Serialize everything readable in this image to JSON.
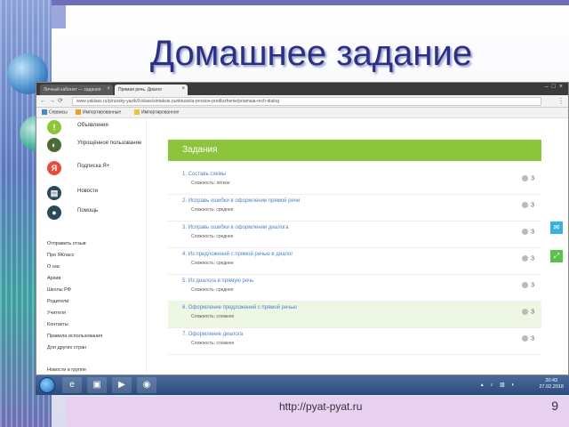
{
  "slide": {
    "title": "Домашнее задание",
    "footer_url": "http://pyat-pyat.ru",
    "page_number": "9"
  },
  "browser": {
    "tabs": [
      {
        "label": "Личный кабинет — задания"
      },
      {
        "label": "Прямая речь. Диалог"
      }
    ],
    "url": "www.yaklass.ru/p/russky-yazik/9-klass/sintaksis-punktuaciia-prostoe-predlozhenie/priamaia-rech-dialog",
    "bookmarks": [
      {
        "label": "Сервисы",
        "color": "#4a86c8"
      },
      {
        "label": "Импортированные",
        "color": "#e8a020"
      },
      {
        "label": "Импортированное",
        "color": "#f0c030"
      }
    ]
  },
  "sidebar": {
    "items": [
      {
        "label": "Объявления",
        "icon": "exclamation-icon",
        "glyph": "!",
        "color": "#8cc43c"
      },
      {
        "label": "Упрощённое пользование",
        "icon": "leaf-icon",
        "glyph": "◐",
        "color": "#4a6a3a"
      },
      {
        "label": "Подписка Я+",
        "icon": "yandex-plus-icon",
        "glyph": "Я",
        "color": "#e84c3c"
      },
      {
        "label": "Новости",
        "icon": "news-icon",
        "glyph": "▤",
        "color": "#2a4a5a"
      },
      {
        "label": "Помощь",
        "icon": "help-icon",
        "glyph": "●",
        "color": "#2a4a5a"
      }
    ],
    "links": [
      "Отправить отзыв",
      "Про ЯКласс",
      "О нас",
      "Архив",
      "Школы РФ",
      "Родители",
      "Учителя",
      "Контакты",
      "Правила использования",
      "Для других стран"
    ],
    "bottom_text": "Новости в группе"
  },
  "main": {
    "header": "Задания",
    "tasks": [
      {
        "num": "1.",
        "title": "Составь схемы",
        "difficulty": "Сложность: лёгкое",
        "score": "3"
      },
      {
        "num": "2.",
        "title": "Исправь ошибки в оформлении прямой речи",
        "difficulty": "Сложность: среднее",
        "score": "3"
      },
      {
        "num": "3.",
        "title": "Исправь ошибки в оформлении диалога",
        "difficulty": "Сложность: среднее",
        "score": "3"
      },
      {
        "num": "4.",
        "title": "Из предложений с прямой речью в диалог",
        "difficulty": "Сложность: среднее",
        "score": "3"
      },
      {
        "num": "5.",
        "title": "Из диалога в прямую речь",
        "difficulty": "Сложность: среднее",
        "score": "3"
      },
      {
        "num": "6.",
        "title": "Оформление предложений с прямой речью",
        "difficulty": "Сложность: сложное",
        "score": "3"
      },
      {
        "num": "7.",
        "title": "Оформление диалога",
        "difficulty": "Сложность: сложное",
        "score": "3"
      }
    ],
    "float_buttons": [
      {
        "icon": "mail-icon",
        "glyph": "✉",
        "color": "#3ab0e0"
      },
      {
        "icon": "expand-icon",
        "glyph": "⤢",
        "color": "#5cc04c"
      }
    ]
  },
  "taskbar": {
    "clock_time": "20:43",
    "clock_date": "27.02.2018"
  }
}
